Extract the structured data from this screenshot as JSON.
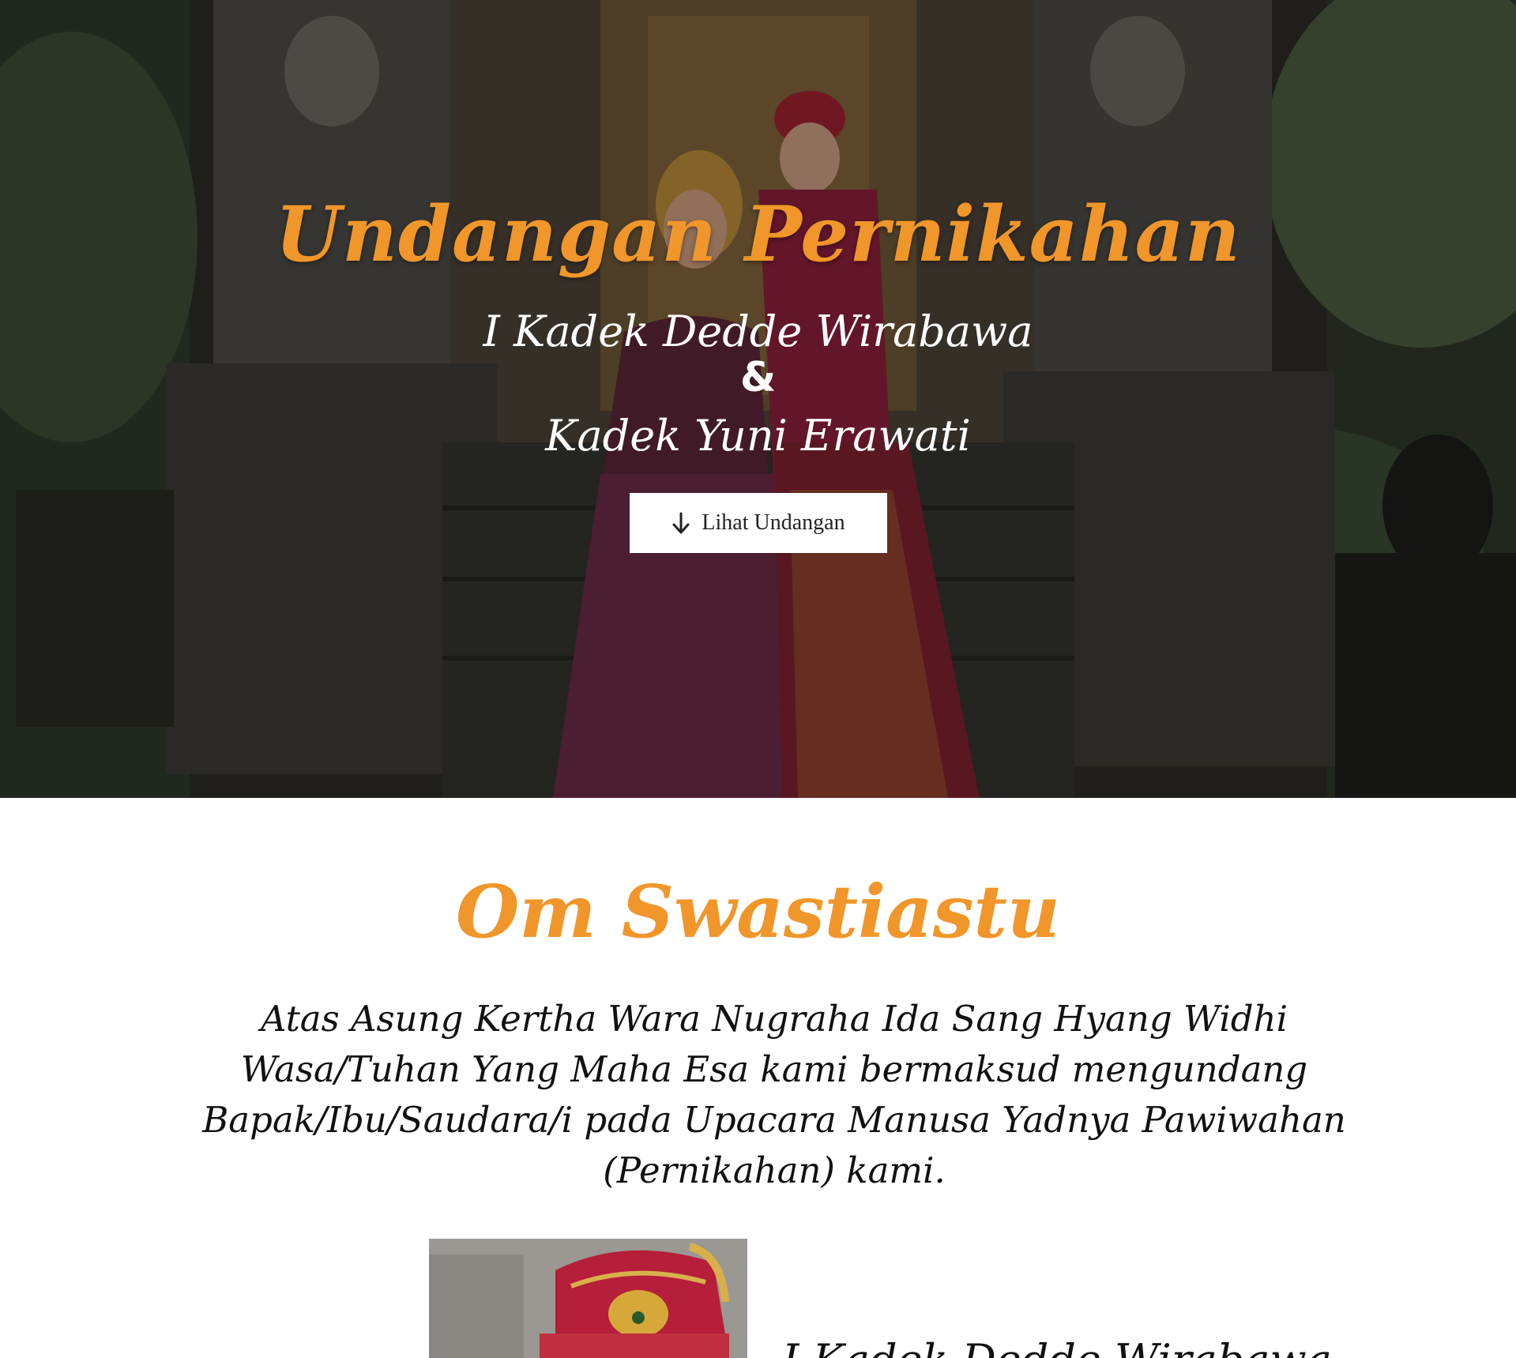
{
  "hero": {
    "title": "Undangan Pernikahan",
    "groom": "I Kadek Dedde Wirabawa",
    "ampersand": "&",
    "bride": "Kadek Yuni Erawati",
    "button_label": "Lihat Undangan",
    "button_icon": "arrow-down-icon"
  },
  "greeting": {
    "title": "Om Swastiastu",
    "text": "Atas Asung Kertha Wara Nugraha Ida Sang Hyang Widhi Wasa/Tuhan Yang Maha Esa kami bermaksud mengundang Bapak/Ibu/Saudara/i pada Upacara Manusa Yadnya Pawiwahan (Pernikahan) kami."
  },
  "couple": {
    "groom_name_partial": "I Kadek Dedde Wirabawa"
  },
  "colors": {
    "accent": "#f0962a",
    "text": "#111111",
    "button_bg": "#ffffff"
  }
}
